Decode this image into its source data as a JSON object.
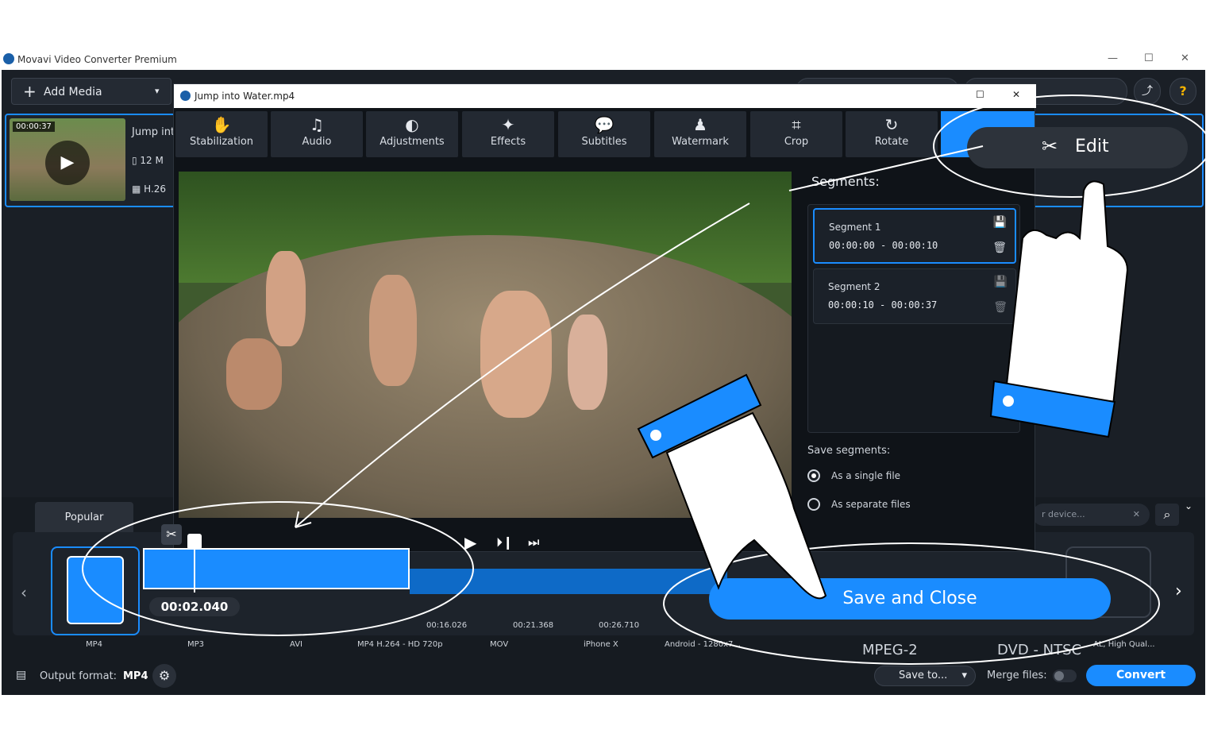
{
  "app": {
    "title": "Movavi Video Converter Premium",
    "add_media": "Add Media"
  },
  "file": {
    "duration": "00:00:37",
    "name": "Jump int",
    "size": "12 M",
    "codec": "H.26"
  },
  "dialog": {
    "title": "Jump into Water.mp4"
  },
  "toolbar": [
    {
      "icon": "stabilization-icon",
      "label": "Stabilization"
    },
    {
      "icon": "audio-icon",
      "label": "Audio"
    },
    {
      "icon": "adjustments-icon",
      "label": "Adjustments"
    },
    {
      "icon": "effects-icon",
      "label": "Effects"
    },
    {
      "icon": "subtitles-icon",
      "label": "Subtitles"
    },
    {
      "icon": "watermark-icon",
      "label": "Watermark"
    },
    {
      "icon": "crop-icon",
      "label": "Crop"
    },
    {
      "icon": "rotate-icon",
      "label": "Rotate"
    }
  ],
  "edit_label": "Edit",
  "segments": {
    "heading": "Segments:",
    "items": [
      {
        "name": "Segment 1",
        "range": "00:00:00 - 00:00:10"
      },
      {
        "name": "Segment 2",
        "range": "00:00:10 - 00:00:37"
      }
    ],
    "save_heading": "Save segments:",
    "opt_single": "As a single file",
    "opt_separate": "As separate files"
  },
  "timeline": {
    "current": "00:02.040",
    "ticks": [
      "00:16.026",
      "00:21.368",
      "00:26.710"
    ]
  },
  "save_close": "Save and Close",
  "bottom": {
    "tab_popular": "Popular",
    "device_placeholder": "r device...",
    "formats": [
      "MP4",
      "MP3",
      "AVI",
      "MP4 H.264 - HD 720p",
      "MOV",
      "iPhone X",
      "Android - 1280x7..."
    ],
    "mpeg2": "MPEG-2",
    "dvd": "DVD - NTSC",
    "hq": "AL, High Qual...",
    "output_label": "Output format:",
    "output_value": "MP4",
    "save_to": "Save to...",
    "merge": "Merge files:",
    "convert": "Convert"
  },
  "colors": {
    "accent": "#1a8cff",
    "bg": "#1a1f26"
  }
}
